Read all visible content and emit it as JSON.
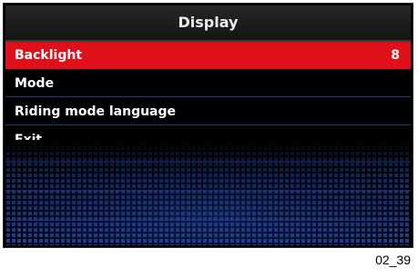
{
  "header": {
    "title": "Display"
  },
  "menu": {
    "items": [
      {
        "label": "Backlight",
        "value": "8"
      },
      {
        "label": "Mode",
        "value": ""
      },
      {
        "label": "Riding mode language",
        "value": ""
      },
      {
        "label": "Exit",
        "value": ""
      }
    ]
  },
  "caption": "02_39",
  "colors": {
    "selected": "#e0101a",
    "background": "#000000",
    "divider": "#1e3c8c"
  }
}
